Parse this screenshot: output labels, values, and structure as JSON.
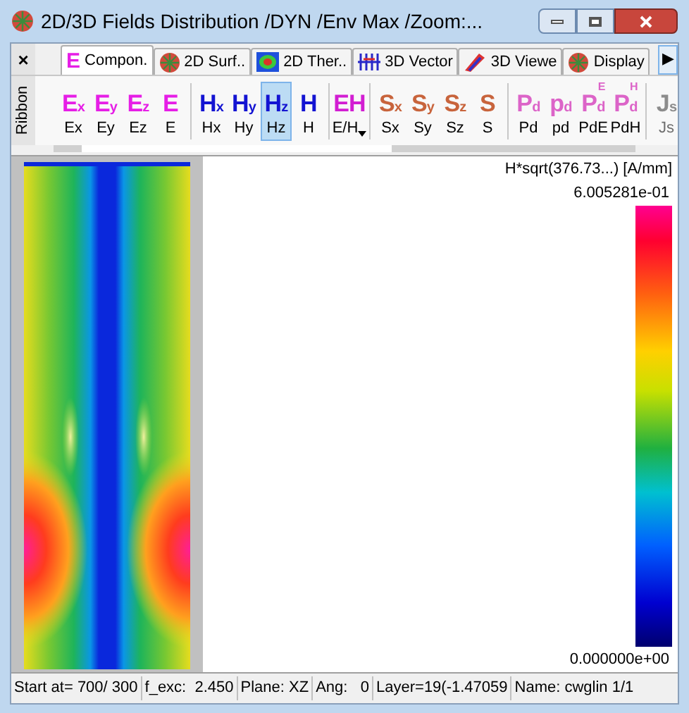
{
  "window": {
    "title": "2D/3D Fields Distribution /DYN /Env Max /Zoom:..."
  },
  "ribbon": {
    "close": "×",
    "label": "Ribbon",
    "more": "▶"
  },
  "tabs": [
    {
      "label": "Compon.",
      "selected": true,
      "kind": "e",
      "glyph": "E"
    },
    {
      "label": "2D Surf..",
      "selected": false,
      "kind": "mesh"
    },
    {
      "label": "2D Ther..",
      "selected": false,
      "kind": "thermal"
    },
    {
      "label": "3D Vector",
      "selected": false,
      "kind": "vector"
    },
    {
      "label": "3D Viewe",
      "selected": false,
      "kind": "viewer"
    },
    {
      "label": "Display",
      "selected": false,
      "kind": "mesh"
    }
  ],
  "tools": [
    {
      "kind": "e",
      "glyph": "E",
      "sub": "x",
      "label": "Ex",
      "selected": false,
      "disabled": false
    },
    {
      "kind": "e",
      "glyph": "E",
      "sub": "y",
      "label": "Ey",
      "selected": false,
      "disabled": false
    },
    {
      "kind": "e",
      "glyph": "E",
      "sub": "z",
      "label": "Ez",
      "selected": false,
      "disabled": false
    },
    {
      "kind": "e",
      "glyph": "E",
      "label": "E",
      "selected": false,
      "disabled": false,
      "group_end": true
    },
    {
      "kind": "h",
      "glyph": "H",
      "sub": "x",
      "label": "Hx",
      "selected": false,
      "disabled": false
    },
    {
      "kind": "h",
      "glyph": "H",
      "sub": "y",
      "label": "Hy",
      "selected": false,
      "disabled": false
    },
    {
      "kind": "h",
      "glyph": "H",
      "sub": "z",
      "label": "Hz",
      "selected": true,
      "disabled": false
    },
    {
      "kind": "h",
      "glyph": "H",
      "label": "H",
      "selected": false,
      "disabled": false,
      "group_end": true
    },
    {
      "kind": "eh",
      "glyph": "EH",
      "label": "E/H",
      "dropdown": true,
      "selected": false,
      "disabled": false,
      "group_end": true
    },
    {
      "kind": "s",
      "glyph": "S",
      "sub": "x",
      "label": "Sx",
      "selected": false,
      "disabled": false
    },
    {
      "kind": "s",
      "glyph": "S",
      "sub": "y",
      "label": "Sy",
      "selected": false,
      "disabled": false
    },
    {
      "kind": "s",
      "glyph": "S",
      "sub": "z",
      "label": "Sz",
      "selected": false,
      "disabled": false
    },
    {
      "kind": "s",
      "glyph": "S",
      "label": "S",
      "selected": false,
      "disabled": false,
      "group_end": true
    },
    {
      "kind": "p",
      "glyph": "P",
      "sub": "d",
      "label": "Pd",
      "selected": false,
      "disabled": false
    },
    {
      "kind": "p",
      "glyph": "p",
      "sub": "d",
      "label": "pd",
      "selected": false,
      "disabled": false
    },
    {
      "kind": "p",
      "glyph": "P",
      "sub": "d",
      "sup": "E",
      "label": "PdE",
      "selected": false,
      "disabled": false
    },
    {
      "kind": "p",
      "glyph": "P",
      "sub": "d",
      "sup": "H",
      "label": "PdH",
      "selected": false,
      "disabled": false,
      "group_end": true
    },
    {
      "kind": "j",
      "glyph": "J",
      "sub": "s",
      "label": "Js",
      "selected": false,
      "disabled": true
    }
  ],
  "plot": {
    "colorbar_title": "H*sqrt(376.73...) [A/mm]",
    "max": "6.005281e-01",
    "min": "0.000000e+00"
  },
  "status_bar": [
    "Start at= 700/ 300",
    "f_exc:  2.450",
    "Plane: XZ",
    "Ang:   0",
    "Layer=19(-1.47059",
    "Name: cwglin 1/1"
  ]
}
